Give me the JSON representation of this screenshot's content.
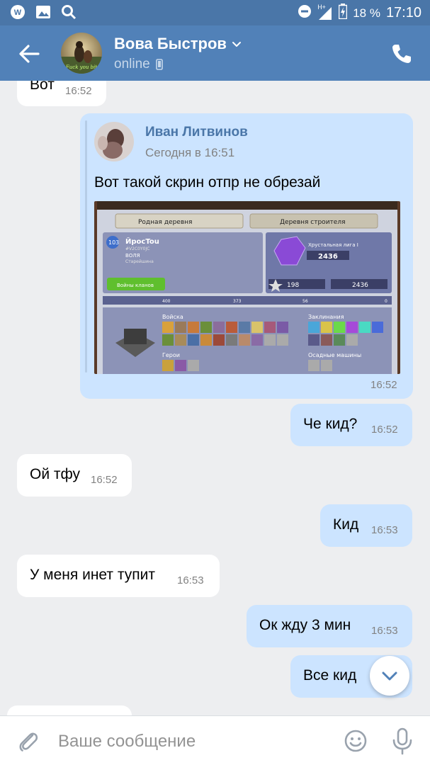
{
  "status_bar": {
    "battery": "18 %",
    "time": "17:10",
    "network": "H+"
  },
  "header": {
    "name": "Вова Быстров",
    "status": "online"
  },
  "messages": [
    {
      "text": "Вот",
      "time": "16:52"
    },
    {
      "forward": {
        "author": "Иван Литвинов",
        "date": "Сегодня в 16:51",
        "text": "Вот такой скрин отпр не обрезай",
        "screenshot": {
          "tab1": "Родная деревня",
          "tab2": "Деревня строителя",
          "player_name": "ЙросTou",
          "player_tag": "#V2C0Y0JC",
          "clan": "ВОЛЯ",
          "role": "Старейшина",
          "level": "103",
          "league": "Хрустальная лига I",
          "trophies": "2436",
          "best_trophies": "2436",
          "war_stars": "198",
          "war_label": "Войны кланов",
          "troops_label": "Войска",
          "spells_label": "Заклинания",
          "heroes_label": "Герои",
          "siege_label": "Осадные машины",
          "donated": "400",
          "received": "373",
          "attacks_won": "56",
          "defenses_won": "0"
        }
      },
      "time": "16:52"
    },
    {
      "text": "Че кид?",
      "time": "16:52"
    },
    {
      "text": "Ой тфу",
      "time": "16:52"
    },
    {
      "text": "Кид",
      "time": "16:53"
    },
    {
      "text": "У меня инет тупит",
      "time": "16:53"
    },
    {
      "text": "Ок жду 3 мин",
      "time": "16:53"
    },
    {
      "text": "Все кид",
      "time": ""
    }
  ],
  "composer": {
    "placeholder": "Ваше сообщение"
  },
  "colors": {
    "header": "#5181b8",
    "statusbar": "#4a76a8",
    "incoming": "#ffffff",
    "outgoing": "#cce4ff",
    "background": "#edeef0",
    "link": "#4a76a8"
  },
  "icons": [
    "back-arrow-icon",
    "chevron-down-icon",
    "phone-icon",
    "mobile-device-icon",
    "paperclip-icon",
    "smile-icon",
    "microphone-icon",
    "arrow-down-icon"
  ]
}
